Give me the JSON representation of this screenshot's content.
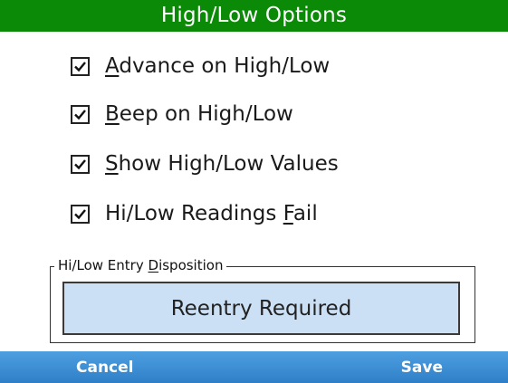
{
  "title": "High/Low Options",
  "options": [
    {
      "mnemonic": "A",
      "rest": "dvance on High/Low",
      "checked": true
    },
    {
      "mnemonic": "B",
      "rest": "eep on High/Low",
      "checked": true
    },
    {
      "mnemonic": "S",
      "rest": "how High/Low Values",
      "checked": true
    },
    {
      "before": "Hi/Low Readings ",
      "mnemonic": "F",
      "rest": "ail",
      "checked": true
    }
  ],
  "disposition": {
    "legend_before": "Hi/Low Entry ",
    "legend_mnemonic": "D",
    "legend_rest": "isposition",
    "value": "Reentry Required"
  },
  "softkeys": {
    "left": "Cancel",
    "right": "Save"
  },
  "colors": {
    "titlebar": "#0a8a06",
    "softbar": "#3d8fd6",
    "disposition_bg": "#cce0f5"
  },
  "icons": {
    "checkbox": "checkmark-icon"
  }
}
